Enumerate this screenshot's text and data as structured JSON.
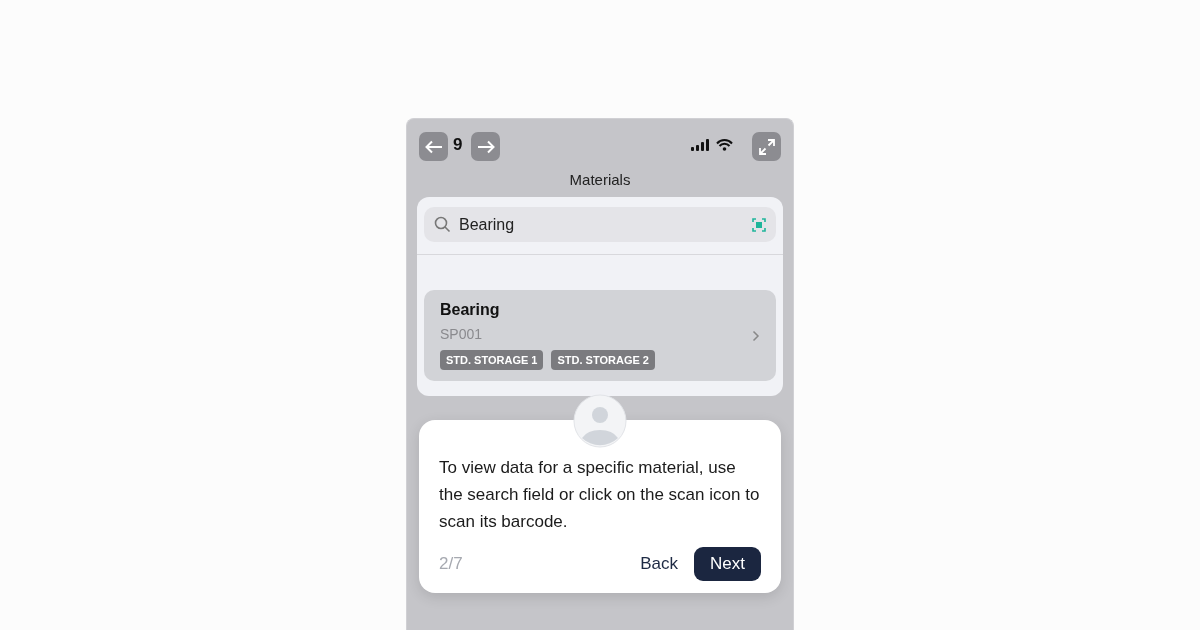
{
  "status_bar": {
    "time": "9"
  },
  "header": {
    "title": "Materials"
  },
  "search": {
    "value": "Bearing"
  },
  "results": [
    {
      "name": "Bearing",
      "code": "SP001",
      "tags": [
        "STD. STORAGE 1",
        "STD. STORAGE 2"
      ]
    }
  ],
  "tour": {
    "text": "To view data for a specific material, use the search field or click on the scan icon to scan its barcode.",
    "step": "2/7",
    "buttons": [
      {
        "label": "Back",
        "kind": "secondary"
      },
      {
        "label": "Next",
        "kind": "primary"
      }
    ]
  }
}
